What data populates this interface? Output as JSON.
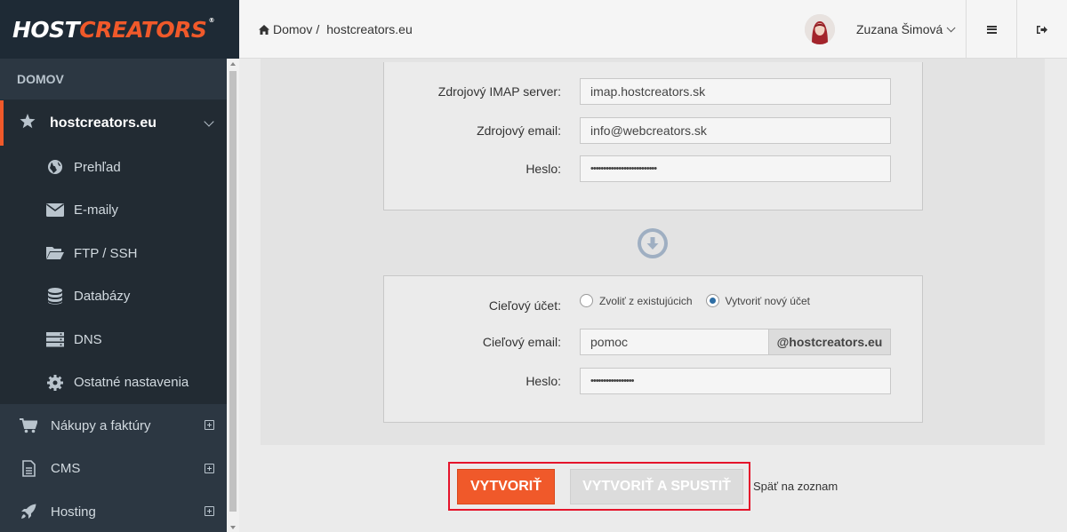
{
  "brand": {
    "logo_white": "HOST",
    "logo_orange": "CREATORS",
    "mark": "®"
  },
  "breadcrumb": {
    "home": "Domov",
    "separator": "/",
    "current": "hostcreators.eu"
  },
  "user": {
    "name": "Zuzana Šimová"
  },
  "sidebar": {
    "section_title": "DOMOV",
    "site": {
      "label": "hostcreators.eu"
    },
    "sub_items": [
      {
        "label": "Prehľad",
        "icon": "globe-icon"
      },
      {
        "label": "E-maily",
        "icon": "envelope-icon"
      },
      {
        "label": "FTP / SSH",
        "icon": "folder-icon"
      },
      {
        "label": "Databázy",
        "icon": "database-icon"
      },
      {
        "label": "DNS",
        "icon": "server-icon"
      },
      {
        "label": "Ostatné nastavenia",
        "icon": "gear-icon"
      }
    ],
    "main_items": [
      {
        "label": "Nákupy a faktúry",
        "icon": "cart-icon"
      },
      {
        "label": "CMS",
        "icon": "file-icon"
      },
      {
        "label": "Hosting",
        "icon": "rocket-icon"
      }
    ]
  },
  "source": {
    "imap_label": "Zdrojový IMAP server:",
    "imap_value": "imap.hostcreators.sk",
    "email_label": "Zdrojový email:",
    "email_value": "info@webcreators.sk",
    "password_label": "Heslo:",
    "password_value": "••••••••••••••••••••••••••"
  },
  "target": {
    "account_label": "Cieľový účet:",
    "option_existing": "Zvoliť z existujúcich",
    "option_new": "Vytvoriť nový účet",
    "email_label": "Cieľový email:",
    "email_value": "pomoc",
    "email_domain": "@hostcreators.eu",
    "password_label": "Heslo:",
    "password_value": "•••••••••••••••••"
  },
  "actions": {
    "create": "VYTVORIŤ",
    "create_run": "VYTVORIŤ A SPUSTIŤ",
    "back": "Späť na zoznam"
  },
  "colors": {
    "accent": "#f0592a",
    "sidebar": "#2c3742",
    "highlight": "#e5142b"
  }
}
